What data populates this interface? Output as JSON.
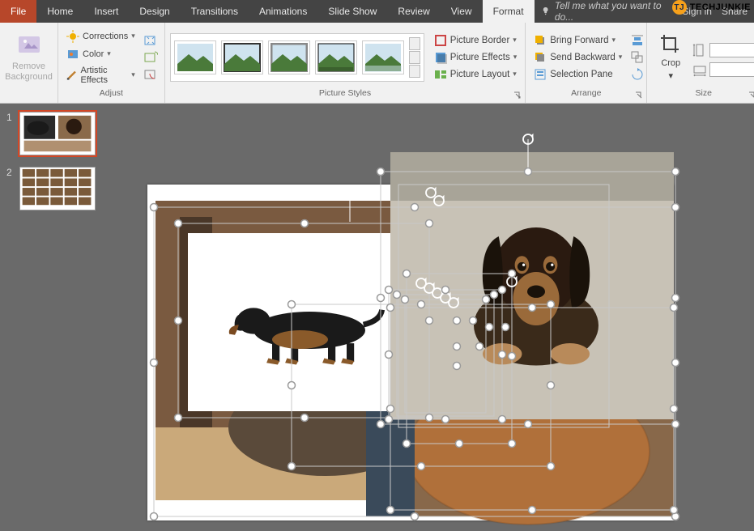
{
  "watermark": {
    "text": "TECHJUNKIE"
  },
  "menubar": {
    "tabs": [
      "File",
      "Home",
      "Insert",
      "Design",
      "Transitions",
      "Animations",
      "Slide Show",
      "Review",
      "View",
      "Format"
    ],
    "active": "Format",
    "search_placeholder": "Tell me what you want to do...",
    "right": {
      "signin": "Sign in",
      "share": "Share"
    }
  },
  "ribbon": {
    "remove_bg": "Remove\nBackground",
    "adjust": {
      "corrections": "Corrections",
      "color": "Color",
      "artistic": "Artistic Effects",
      "label": "Adjust"
    },
    "styles": {
      "border": "Picture Border",
      "effects": "Picture Effects",
      "layout": "Picture Layout",
      "label": "Picture Styles"
    },
    "arrange": {
      "forward": "Bring Forward",
      "backward": "Send Backward",
      "selection": "Selection Pane",
      "label": "Arrange"
    },
    "crop": "Crop",
    "size": {
      "label": "Size"
    }
  },
  "slides": {
    "items": [
      {
        "num": "1"
      },
      {
        "num": "2"
      }
    ]
  }
}
